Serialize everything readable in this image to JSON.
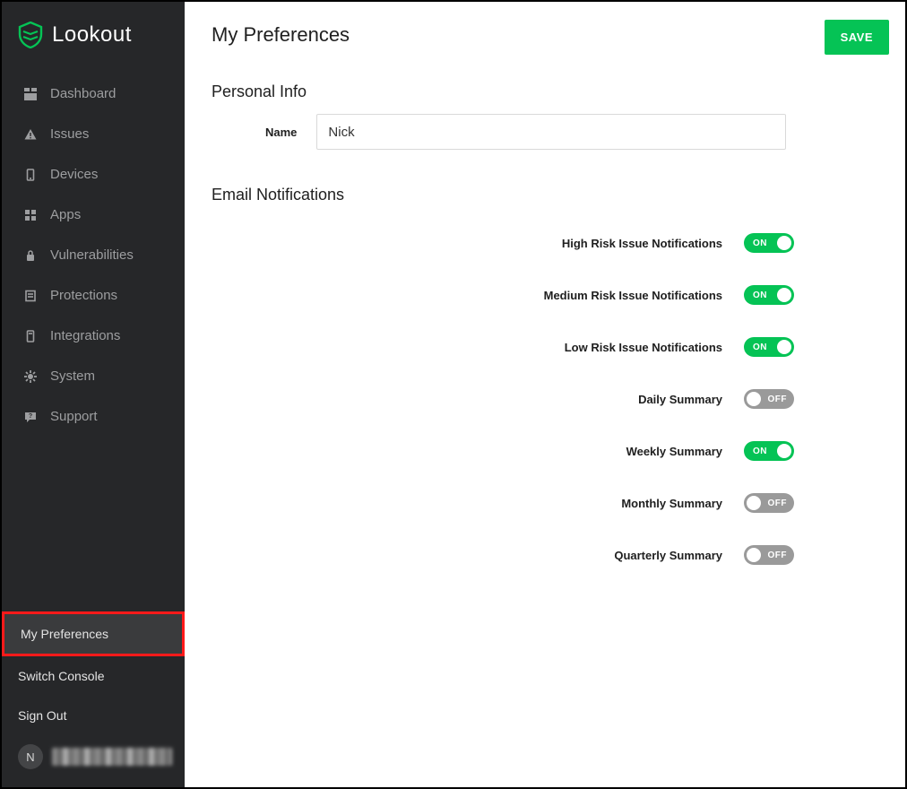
{
  "brand": {
    "name": "Lookout"
  },
  "sidebar": {
    "items": [
      {
        "label": "Dashboard"
      },
      {
        "label": "Issues"
      },
      {
        "label": "Devices"
      },
      {
        "label": "Apps"
      },
      {
        "label": "Vulnerabilities"
      },
      {
        "label": "Protections"
      },
      {
        "label": "Integrations"
      },
      {
        "label": "System"
      },
      {
        "label": "Support"
      }
    ],
    "bottom": [
      {
        "label": "My Preferences",
        "active": true
      },
      {
        "label": "Switch Console",
        "active": false
      },
      {
        "label": "Sign Out",
        "active": false
      }
    ],
    "user_initial": "N"
  },
  "page": {
    "title": "My Preferences",
    "save_label": "SAVE"
  },
  "personal_info": {
    "heading": "Personal Info",
    "name_label": "Name",
    "name_value": "Nick"
  },
  "email_notifications": {
    "heading": "Email Notifications",
    "rows": [
      {
        "label": "High Risk Issue Notifications",
        "state": "on",
        "text": "ON"
      },
      {
        "label": "Medium Risk Issue Notifications",
        "state": "on",
        "text": "ON"
      },
      {
        "label": "Low Risk Issue Notifications",
        "state": "on",
        "text": "ON"
      },
      {
        "label": "Daily Summary",
        "state": "off",
        "text": "OFF"
      },
      {
        "label": "Weekly Summary",
        "state": "on",
        "text": "ON"
      },
      {
        "label": "Monthly Summary",
        "state": "off",
        "text": "OFF"
      },
      {
        "label": "Quarterly Summary",
        "state": "off",
        "text": "OFF"
      }
    ]
  }
}
